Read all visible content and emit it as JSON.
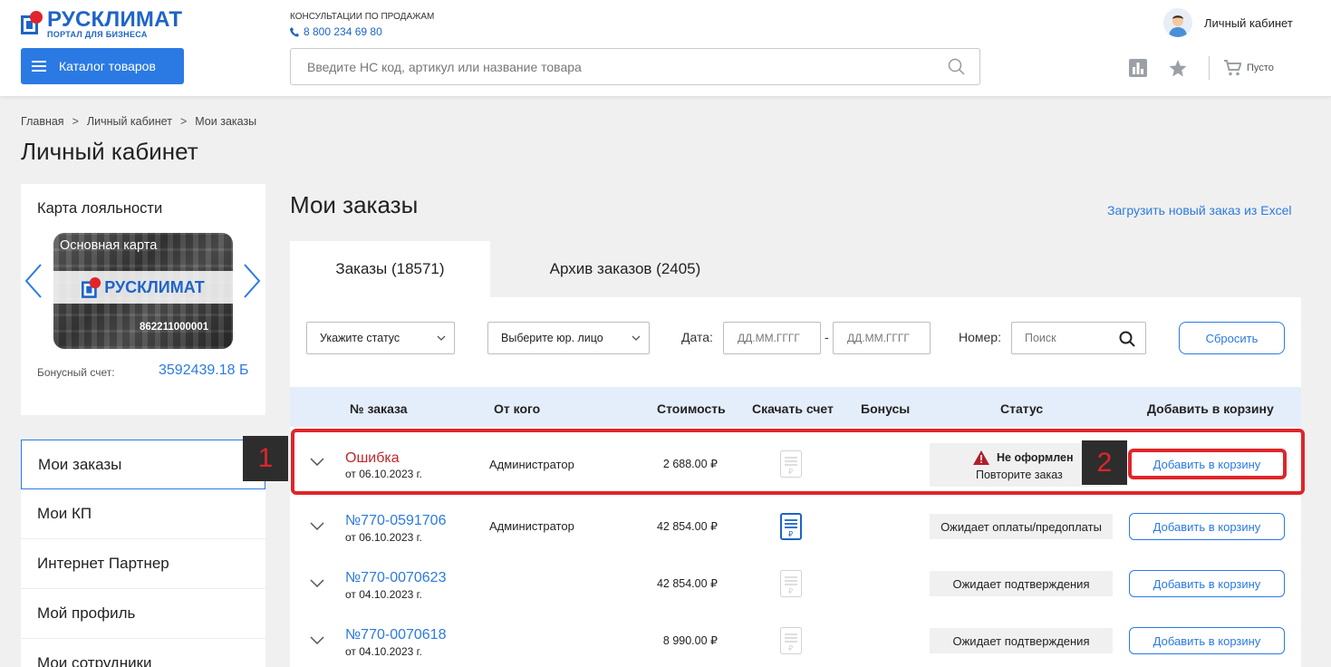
{
  "header": {
    "logo": {
      "name": "РУСКЛИМАТ",
      "sub": "ПОРТАЛ ДЛЯ БИЗНЕСА"
    },
    "consult_label": "КОНСУЛЬТАЦИИ ПО ПРОДАЖАМ",
    "phone": "8 800 234 69 80",
    "catalog_label": "Каталог товаров",
    "search_placeholder": "Введите НС код, артикул или название товара",
    "account_label": "Личный кабинет",
    "cart_label": "Пусто"
  },
  "breadcrumb": [
    "Главная",
    ">",
    "Личный кабинет",
    ">",
    "Мои заказы"
  ],
  "page_title": "Личный кабинет",
  "loyalty": {
    "title": "Карта лояльности",
    "card_name": "Основная карта",
    "card_brand": "РУСКЛИМАТ",
    "card_number": "862211000001",
    "bonus_label": "Бонусный счет:",
    "bonus_value": "3592439.18 Б"
  },
  "sidenav": [
    {
      "label": "Мои заказы",
      "active": true
    },
    {
      "label": "Мои КП",
      "active": false
    },
    {
      "label": "Интернет Партнер",
      "active": false
    },
    {
      "label": "Мой профиль",
      "active": false
    },
    {
      "label": "Мои сотрудники",
      "active": false
    }
  ],
  "main": {
    "title": "Мои заказы",
    "excel_link": "Загрузить новый заказ из Excel",
    "tabs": [
      {
        "label": "Заказы (18571)",
        "active": true
      },
      {
        "label": "Архив заказов (2405)",
        "active": false
      }
    ],
    "filters": {
      "status_placeholder": "Укажите статус",
      "entity_placeholder": "Выберите юр. лицо",
      "date_label": "Дата:",
      "date_from": "ДД.ММ.ГГГГ",
      "date_dash": "-",
      "date_to": "ДД.ММ.ГГГГ",
      "number_label": "Номер:",
      "number_placeholder": "Поиск",
      "reset_label": "Сбросить"
    },
    "columns": [
      "№ заказа",
      "От кого",
      "Стоимость",
      "Скачать счет",
      "Бонусы",
      "Статус",
      "Добавить в корзину"
    ],
    "orders": [
      {
        "number": "Ошибка",
        "date": "от 06.10.2023 г.",
        "from": "Администратор",
        "price": "2 688.00 ₽",
        "invoice": "inactive",
        "status_line1": "Не оформлен",
        "status_line2": "Повторите заказ",
        "error": true,
        "add_label": "Добавить в корзину"
      },
      {
        "number": "№770-0591706",
        "date": "от 06.10.2023 г.",
        "from": "Администратор",
        "price": "42 854.00 ₽",
        "invoice": "active",
        "status": "Ожидает оплаты/предоплаты",
        "error": false,
        "add_label": "Добавить в корзину"
      },
      {
        "number": "№770-0070623",
        "date": "от 04.10.2023 г.",
        "from": "",
        "price": "42 854.00 ₽",
        "invoice": "inactive",
        "status": "Ожидает подтверждения",
        "error": false,
        "add_label": "Добавить в корзину"
      },
      {
        "number": "№770-0070618",
        "date": "от 04.10.2023 г.",
        "from": "",
        "price": "8 990.00 ₽",
        "invoice": "inactive",
        "status": "Ожидает подтверждения",
        "error": false,
        "add_label": "Добавить в корзину"
      }
    ]
  },
  "annotations": {
    "badge1": "1",
    "badge2": "2",
    "highlight_color": "#e0252a"
  },
  "colors": {
    "accent": "#2b7ae4",
    "error": "#c0282d",
    "header_row": "#e4eefa"
  }
}
